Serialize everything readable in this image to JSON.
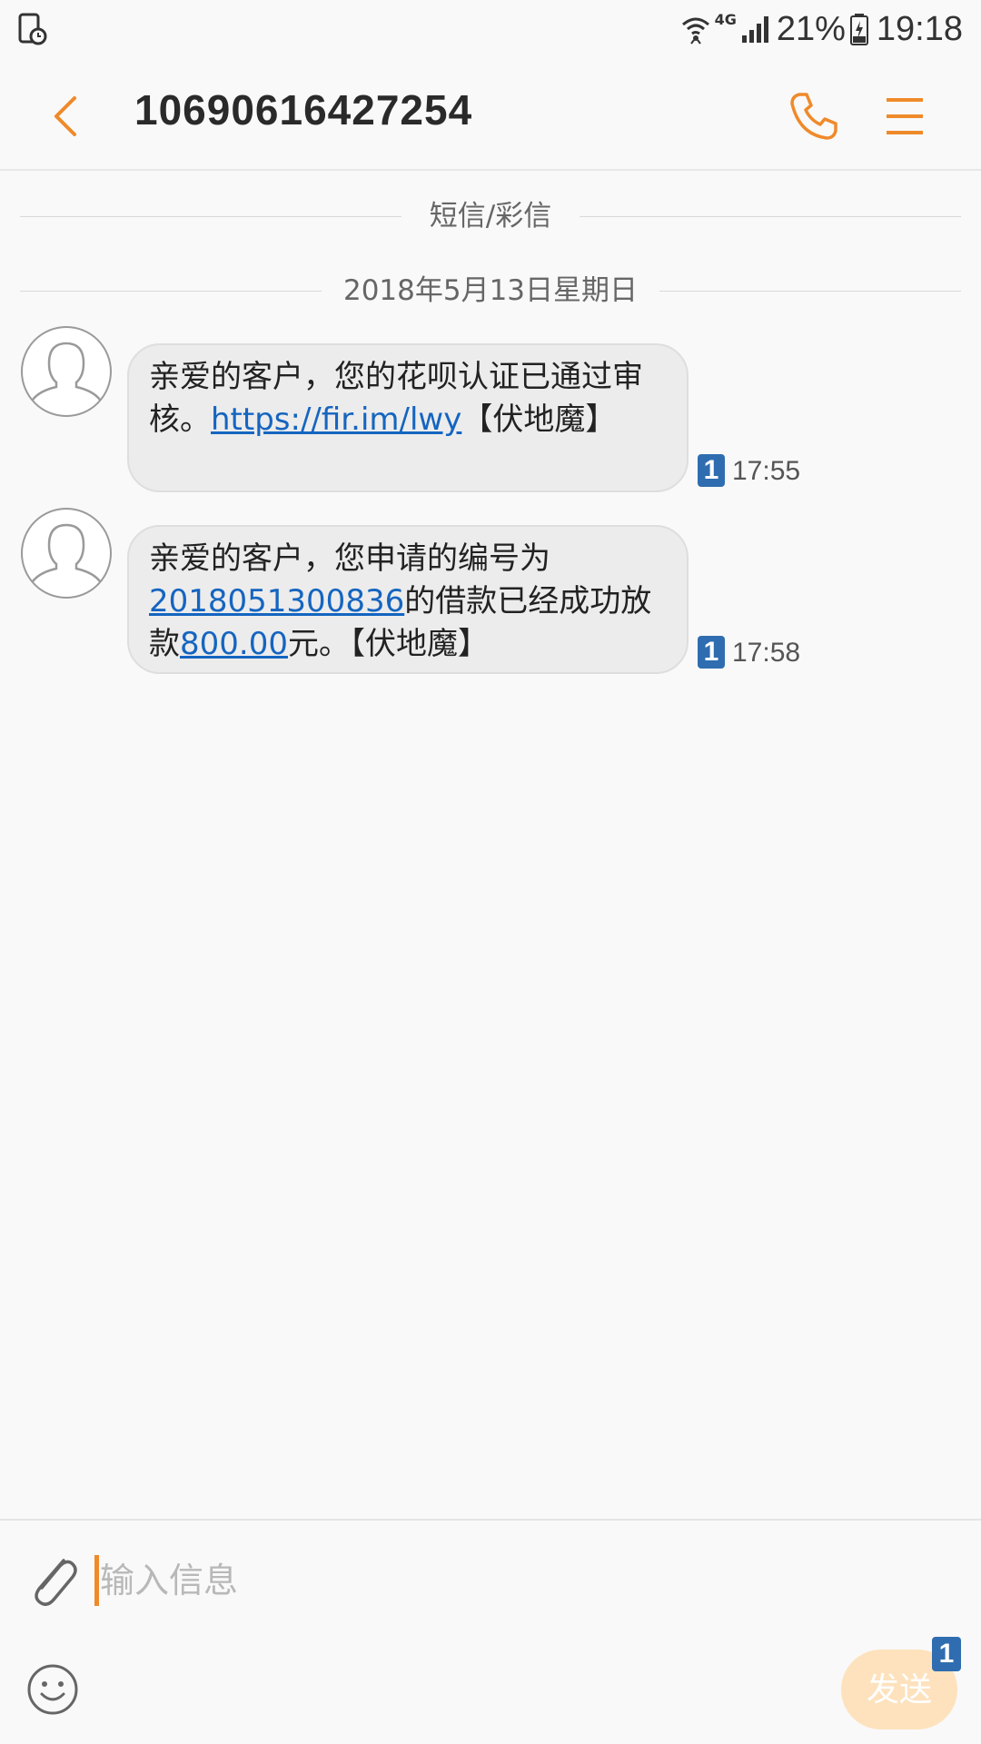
{
  "status_bar": {
    "network_type": "4G",
    "battery_percent": "21%",
    "time": "19:18",
    "icons": [
      "screen-record-icon",
      "wifi-icon",
      "signal-icon",
      "battery-charging-icon"
    ]
  },
  "header": {
    "title": "10690616427254",
    "icons": [
      "back-arrow-icon",
      "phone-icon",
      "menu-icon"
    ]
  },
  "conversation": {
    "section_label": "短信/彩信",
    "date_label": "2018年5月13日星期日",
    "messages": [
      {
        "parts": [
          "亲爱的客户，您的花呗认证已通过审核。",
          "https://fir.im/lwy",
          "【伏地魔】"
        ],
        "sim": "1",
        "time": "17:55"
      },
      {
        "parts": [
          "亲爱的客户，您申请的编号为",
          "2018051300836",
          "的借款已经成功放款",
          "800.00",
          "元。【伏地魔】"
        ],
        "sim": "1",
        "time": "17:58"
      }
    ]
  },
  "composer": {
    "placeholder": "输入信息",
    "send_label": "发送",
    "send_sim": "1",
    "icons": [
      "paperclip-icon",
      "emoji-icon"
    ]
  },
  "colors": {
    "accent": "#ef8a2a",
    "link": "#1565c0",
    "sim_badge": "#2f6db0",
    "bubble": "#ececec",
    "send_disabled": "#fde2bd"
  }
}
